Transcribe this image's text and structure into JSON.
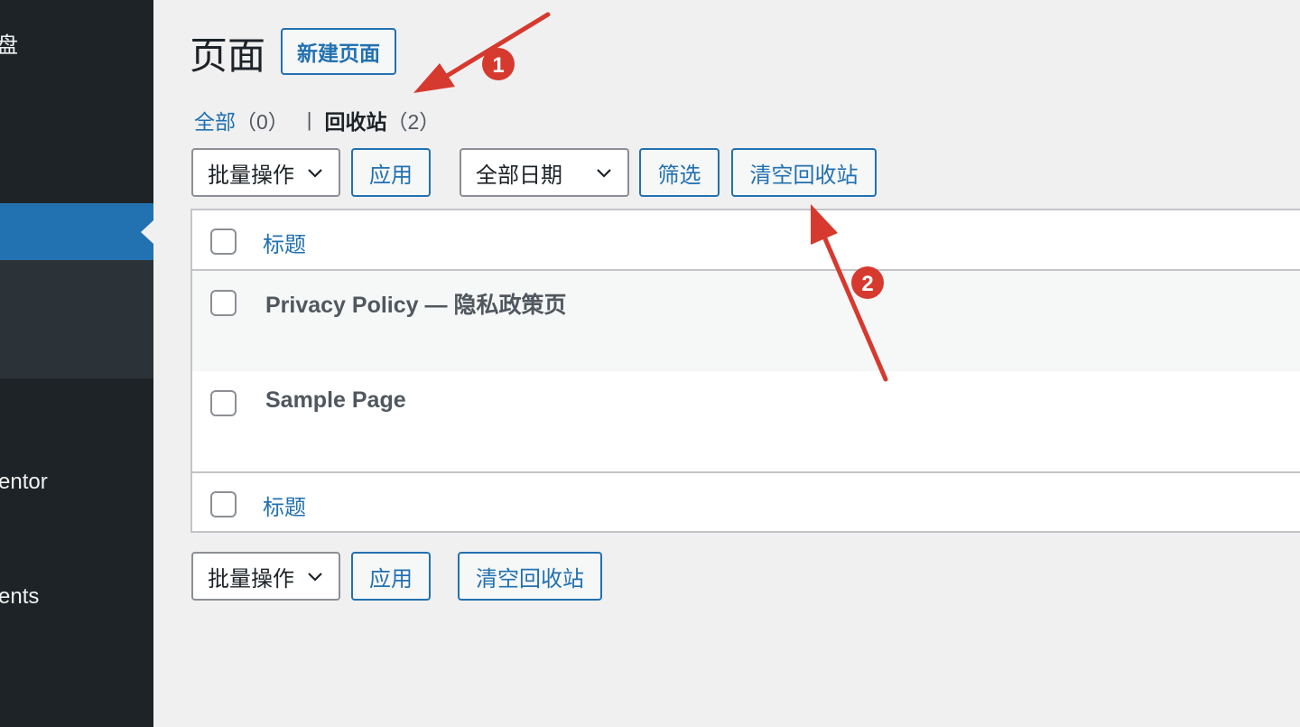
{
  "sidebar": {
    "items": [
      {
        "label": "盘"
      },
      {
        "label": "entor"
      },
      {
        "label": "ents"
      }
    ]
  },
  "header": {
    "title": "页面",
    "add_new_label": "新建页面"
  },
  "views": {
    "all_label": "全部",
    "all_count": "（0）",
    "separator": "|",
    "trash_label": "回收站",
    "trash_count": "（2）"
  },
  "toolbar_top": {
    "bulk_actions": "批量操作",
    "apply": "应用",
    "date_filter": "全部日期",
    "filter": "筛选",
    "empty_trash": "清空回收站"
  },
  "table": {
    "column_title": "标题",
    "rows": [
      {
        "title": "Privacy Policy — 隐私政策页"
      },
      {
        "title": "Sample Page"
      }
    ]
  },
  "toolbar_bottom": {
    "bulk_actions": "批量操作",
    "apply": "应用",
    "empty_trash": "清空回收站"
  },
  "annotations": {
    "marker_1": "1",
    "marker_2": "2",
    "color": "#d63a2f"
  },
  "colors": {
    "accent": "#2271b1",
    "sidebar_bg": "#1d2327",
    "page_bg": "#f0f0f1"
  }
}
